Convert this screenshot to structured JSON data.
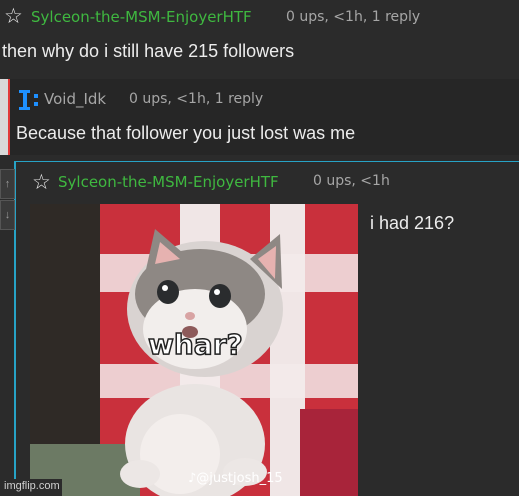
{
  "comments": [
    {
      "username": "Sylceon-the-MSM-EnjoyerHTF",
      "meta": "0 ups, <1h, 1 reply",
      "text": "then why do i still have 215 followers",
      "icon": "star-icon"
    },
    {
      "username": "Void_Idk",
      "meta": "0 ups, <1h, 1 reply",
      "text": "Because that follower you just lost was me",
      "avatar_glyph": "I:",
      "icon": "avatar"
    },
    {
      "username": "Sylceon-the-MSM-EnjoyerHTF",
      "meta": "0 ups, <1h",
      "text": "i had 216?",
      "icon": "star-icon",
      "image": {
        "caption": "whar?",
        "watermark": "@justjosh_15",
        "description_icon": "kitten-photo"
      }
    }
  ],
  "vote_icons": [
    "upvote-arrow-icon",
    "downvote-arrow-icon"
  ],
  "site_watermark": "imgflip.com",
  "colors": {
    "background": "#2b2b2b",
    "username": "#3fb840",
    "meta": "#a6a6a6",
    "text": "#ececec",
    "thread_line_blue": "#27a3c6",
    "thread_line_red": "#e23a3a"
  }
}
